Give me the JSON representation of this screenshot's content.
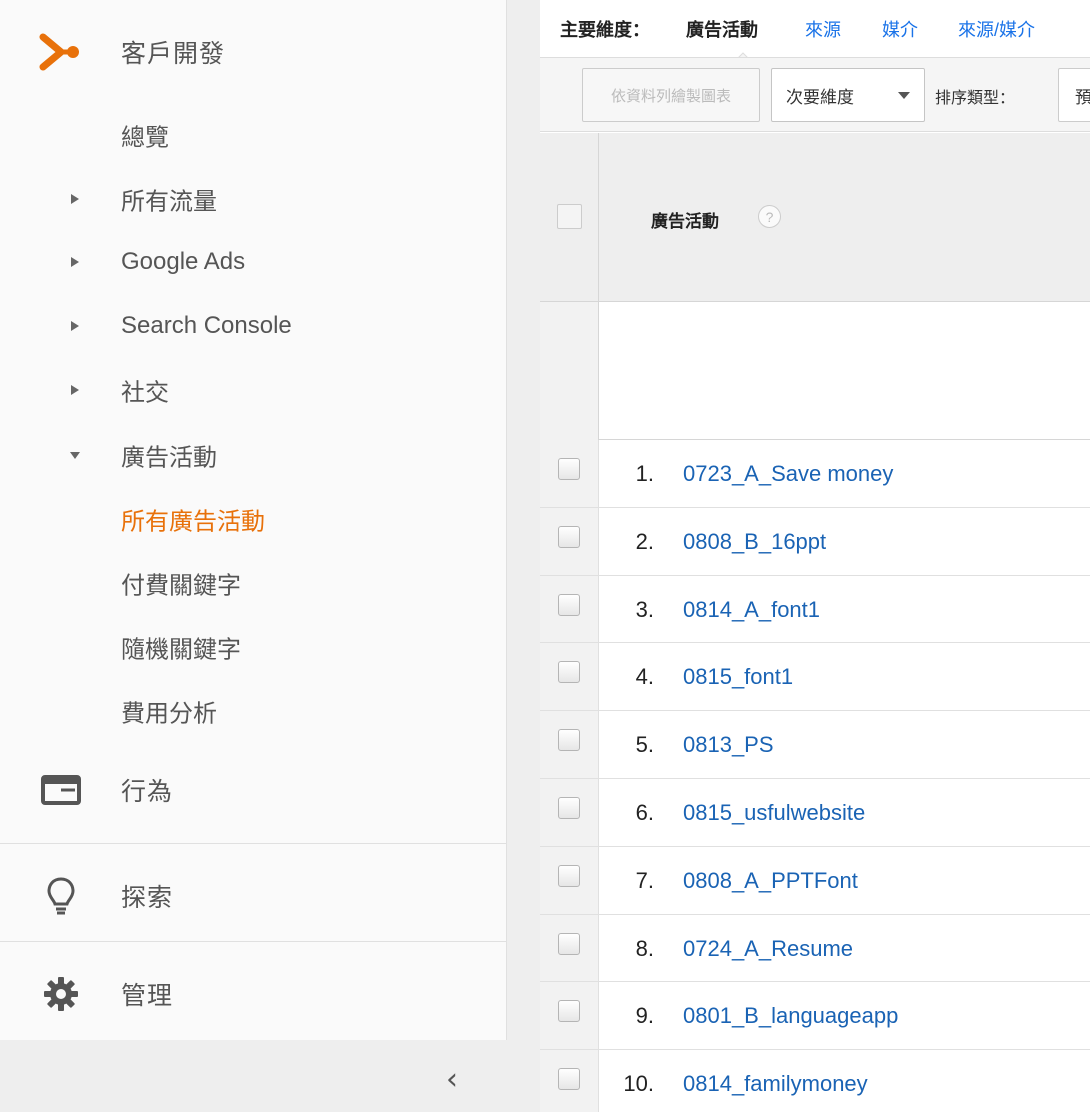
{
  "sidebar": {
    "section_acquisition": {
      "label": "客戶開發",
      "icon": "acquisition-icon",
      "accent": "#e8710a"
    },
    "items": [
      {
        "label": "總覽",
        "arrow": "none"
      },
      {
        "label": "所有流量",
        "arrow": "right"
      },
      {
        "label": "Google Ads",
        "arrow": "right"
      },
      {
        "label": "Search Console",
        "arrow": "right"
      },
      {
        "label": "社交",
        "arrow": "right"
      },
      {
        "label": "廣告活動",
        "arrow": "down"
      },
      {
        "label": "所有廣告活動",
        "arrow": "none",
        "active": true
      },
      {
        "label": "付費關鍵字",
        "arrow": "none"
      },
      {
        "label": "隨機關鍵字",
        "arrow": "none"
      },
      {
        "label": "費用分析",
        "arrow": "none"
      }
    ],
    "section_behavior": {
      "label": "行為",
      "icon": "behavior-icon"
    },
    "section_discover": {
      "label": "探索",
      "icon": "lightbulb-icon"
    },
    "section_admin": {
      "label": "管理",
      "icon": "gear-icon"
    },
    "collapse": "‹"
  },
  "dimensions": {
    "label": "主要維度：",
    "current": "廣告活動",
    "links": [
      "來源",
      "媒介",
      "來源/媒介"
    ]
  },
  "toolbar": {
    "plot_rows": "依資料列繪製圖表",
    "secondary_dimension": "次要維度",
    "sort_type_label": "排序類型：",
    "sort_value": "預"
  },
  "table": {
    "header": "廣告活動",
    "help": "?",
    "rows": [
      {
        "num": "1.",
        "name": "0723_A_Save money"
      },
      {
        "num": "2.",
        "name": "0808_B_16ppt"
      },
      {
        "num": "3.",
        "name": "0814_A_font1"
      },
      {
        "num": "4.",
        "name": "0815_font1"
      },
      {
        "num": "5.",
        "name": "0813_PS"
      },
      {
        "num": "6.",
        "name": "0815_usfulwebsite"
      },
      {
        "num": "7.",
        "name": "0808_A_PPTFont"
      },
      {
        "num": "8.",
        "name": "0724_A_Resume"
      },
      {
        "num": "9.",
        "name": "0801_B_languageapp"
      },
      {
        "num": "10.",
        "name": "0814_familymoney"
      }
    ]
  },
  "colors": {
    "accent": "#e8710a",
    "link": "#1a63b4"
  }
}
